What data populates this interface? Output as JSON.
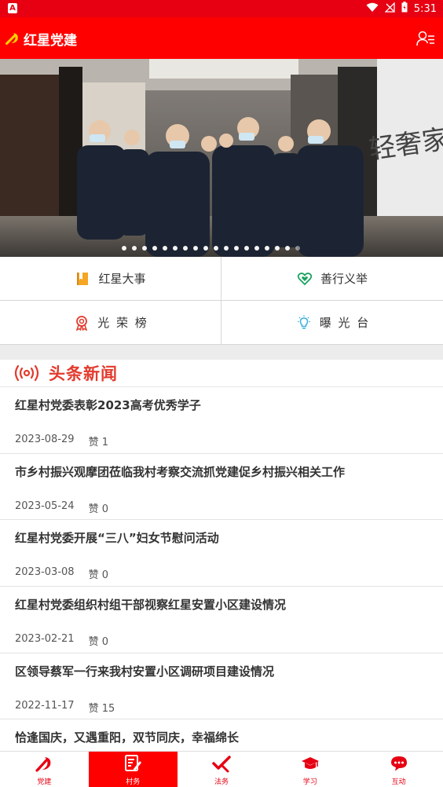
{
  "status_bar": {
    "badge": "A",
    "time": "5:31"
  },
  "app_bar": {
    "title": "红星党建"
  },
  "banner": {
    "slide_count": 18,
    "active_index": 17,
    "sign_text": "轻奢家"
  },
  "quick_links": [
    {
      "label": "红星大事",
      "icon": "bookmark-book-icon",
      "color": "#f5a623"
    },
    {
      "label": "善行义举",
      "icon": "heart-hands-icon",
      "color": "#1aa260"
    },
    {
      "label": "光 荣 榜",
      "icon": "medal-icon",
      "color": "#e23b2d"
    },
    {
      "label": "曝 光 台",
      "icon": "lightbulb-icon",
      "color": "#3ab0e6"
    }
  ],
  "news": {
    "header": "头条新闻",
    "likes_prefix": "赞",
    "items": [
      {
        "title": "红星村党委表彰2023高考优秀学子",
        "date": "2023-08-29",
        "likes": "1"
      },
      {
        "title": "市乡村振兴观摩团莅临我村考察交流抓党建促乡村振兴相关工作",
        "date": "2023-05-24",
        "likes": "0"
      },
      {
        "title": "红星村党委开展“三八”妇女节慰问活动",
        "date": "2023-03-08",
        "likes": "0"
      },
      {
        "title": "红星村党委组织村组干部视察红星安置小区建设情况",
        "date": "2023-02-21",
        "likes": "0"
      },
      {
        "title": "区领导蔡军一行来我村安置小区调研项目建设情况",
        "date": "2022-11-17",
        "likes": "15"
      },
      {
        "title": "恰逢国庆，又遇重阳，双节同庆，幸福绵长",
        "date": "",
        "likes": ""
      }
    ]
  },
  "bottom_nav": [
    {
      "label": "党建",
      "icon": "party-emblem-icon",
      "active": false
    },
    {
      "label": "村务",
      "icon": "edit-document-icon",
      "active": true
    },
    {
      "label": "法务",
      "icon": "gavel-icon",
      "active": false
    },
    {
      "label": "学习",
      "icon": "graduation-cap-icon",
      "active": false
    },
    {
      "label": "互动",
      "icon": "chat-bubble-icon",
      "active": false
    }
  ],
  "colors": {
    "primary_red": "#ff0000",
    "status_red": "#e60012",
    "headline_red": "#e23b2d"
  }
}
